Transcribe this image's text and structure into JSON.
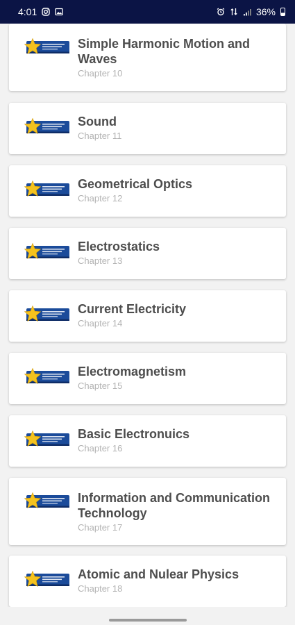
{
  "status_bar": {
    "time": "4:01",
    "battery": "36%"
  },
  "chapters": [
    {
      "title": "Simple Harmonic Motion and Waves",
      "subtitle": "Chapter 10",
      "logo": "star-badge-logo"
    },
    {
      "title": "Sound",
      "subtitle": "Chapter 11",
      "logo": "star-badge-logo"
    },
    {
      "title": "Geometrical Optics",
      "subtitle": "Chapter 12",
      "logo": "star-badge-logo"
    },
    {
      "title": "Electrostatics",
      "subtitle": "Chapter 13",
      "logo": "star-badge-logo"
    },
    {
      "title": "Current Electricity",
      "subtitle": "Chapter 14",
      "logo": "star-badge-logo"
    },
    {
      "title": "Electromagnetism",
      "subtitle": "Chapter 15",
      "logo": "star-badge-logo"
    },
    {
      "title": "Basic Electronuics",
      "subtitle": "Chapter 16",
      "logo": "star-badge-logo"
    },
    {
      "title": "Information and Communication Technology",
      "subtitle": "Chapter 17",
      "logo": "star-badge-logo"
    },
    {
      "title": "Atomic and Nulear Physics",
      "subtitle": "Chapter 18",
      "logo": "star-badge-logo"
    }
  ],
  "colors": {
    "status_bar_bg": "#0b1445",
    "badge_blue": "#1b4b9a",
    "star_gold": "#f4c21e",
    "title_text": "#4d4d4d",
    "subtitle_text": "#b3b3b3"
  }
}
